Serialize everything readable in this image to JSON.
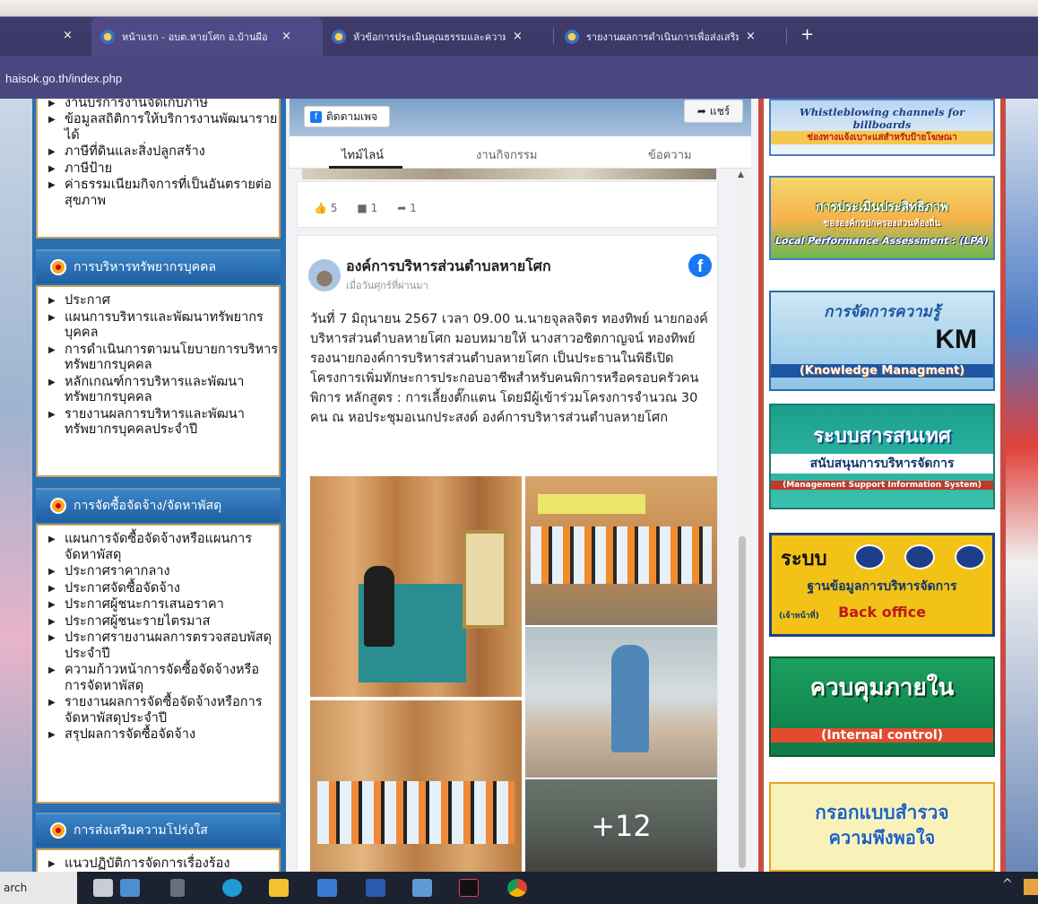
{
  "browser": {
    "tabs": [
      {
        "label": "หน้าแรก - อบต.หายโศก อ.บ้านผือ"
      },
      {
        "label": "หัวข้อการประเมินคุณธรรมและความโปร่งใส"
      },
      {
        "label": "รายงานผลการดำเนินการเพื่อส่งเสริม"
      }
    ],
    "close_glyph": "×",
    "new_tab_glyph": "+",
    "url": "haisok.go.th/index.php"
  },
  "sidebar": {
    "top_items": [
      "งานบริการงานจัดเก็บภาษี",
      "ข้อมูลสถิติการให้บริการงานพัฒนารายได้",
      "ภาษีที่ดินและสิ่งปลูกสร้าง",
      "ภาษีป้าย",
      "ค่าธรรมเนียมกิจการที่เป็นอันตรายต่อสุขภาพ"
    ],
    "sections": [
      {
        "title": "การบริหารทรัพยากรบุคคล",
        "items": [
          "ประกาศ",
          "แผนการบริหารและพัฒนาทรัพยากรบุคคล",
          "การดำเนินการตามนโยบายการบริหารทรัพยากรบุคคล",
          "หลักเกณฑ์การบริหารและพัฒนาทรัพยากรบุคคล",
          "รายงานผลการบริหารและพัฒนาทรัพยากรบุคคลประจำปี"
        ]
      },
      {
        "title": "การจัดซื้อจัดจ้าง/จัดหาพัสดุ",
        "items": [
          "แผนการจัดซื้อจัดจ้างหรือแผนการจัดหาพัสดุ",
          "ประกาศราคากลาง",
          "ประกาศจัดซื้อจัดจ้าง",
          "ประกาศผู้ชนะการเสนอราคา",
          "ประกาศผู้ชนะรายไตรมาส",
          "ประกาศรายงานผลการตรวจสอบพัสดุประจำปี",
          "ความก้าวหน้าการจัดซื้อจัดจ้างหรือการจัดหาพัสดุ",
          "รายงานผลการจัดซื้อจัดจ้างหรือการจัดหาพัสดุประจำปี",
          "สรุปผลการจัดซื้อจัดจ้าง"
        ]
      },
      {
        "title": "การส่งเสริมความโปร่งใส",
        "items": [
          "แนวปฏิบัติการจัดการเรื่องร้อง"
        ]
      }
    ]
  },
  "feed": {
    "follow_label": "ติดตามเพจ",
    "share_label": "แชร์",
    "tabs": [
      "ไทม์ไลน์",
      "งานกิจกรรม",
      "ข้อความ"
    ],
    "prev_reactions": {
      "likes": "5",
      "comments": "1",
      "shares": "1"
    },
    "post": {
      "author": "องค์การบริหารส่วนตำบลหายโศก",
      "time": "เมื่อวันศุกร์ที่ผ่านมา",
      "text": "วันที่ 7 มิถุนายน 2567 เวลา 09.00 น.นายจุลลจิตร ทองทิพย์ นายกองค์บริหารส่วนตำบลหายโศก มอบหมายให้ นางสาวอชิตกาญจน์ ทองทิพย์ รองนายกองค์การบริหารส่วนตำบลหายโศก เป็นประธานในพิธีเปิดโครงการเพิ่มทักษะการประกอบอาชีพสำหรับคนพิการหรือครอบครัวคนพิการ หลักสูตร : การเลี้ยงตั๊กแตน โดยมีผู้เข้าร่วมโครงการจำนวณ 30 คน ณ หอประชุมอเนกประสงด์ องค์การบริหารส่วนตำบลหายโศก",
      "more_photos": "+12"
    }
  },
  "banners": {
    "whistle_en": "Whistleblowing channels for billboards",
    "whistle_th": "ช่องทางแจ้งเบาะแสสำหรับป้ายโฆษณา",
    "lpa_th1": "การประเมินประสิทธิภาพ",
    "lpa_th2": "ขององค์กรปกครองส่วนท้องถิ่น",
    "lpa_en": "Local Performance Assessment : (LPA)",
    "km_th": "การจัดการความรู้",
    "km_abbr": "KM",
    "km_en": "(Knowledge Managment)",
    "mis_th1": "ระบบสารสนเทศ",
    "mis_th2": "สนับสนุนการบริหารจัดการ",
    "mis_en": "(Management Support Information System)",
    "bo_sys": "ระบบ",
    "bo_th": "ฐานข้อมูลการบริหารจัดการ",
    "bo_sub": "(เจ้าหน้าที่)",
    "bo_en": "Back office",
    "ic_th": "ควบคุมภายใน",
    "ic_en": "(Internal control)",
    "survey_th1": "กรอกแบบสำรวจ",
    "survey_th2": "ความพึงพอใจ"
  },
  "taskbar": {
    "search_text": "arch",
    "tray_glyph": "^"
  },
  "colors": {
    "browser_chrome": "#3b3866",
    "sidebar_blue": "#2a6fb0",
    "facebook_blue": "#1877f2",
    "right_border_red": "#c94c43"
  }
}
